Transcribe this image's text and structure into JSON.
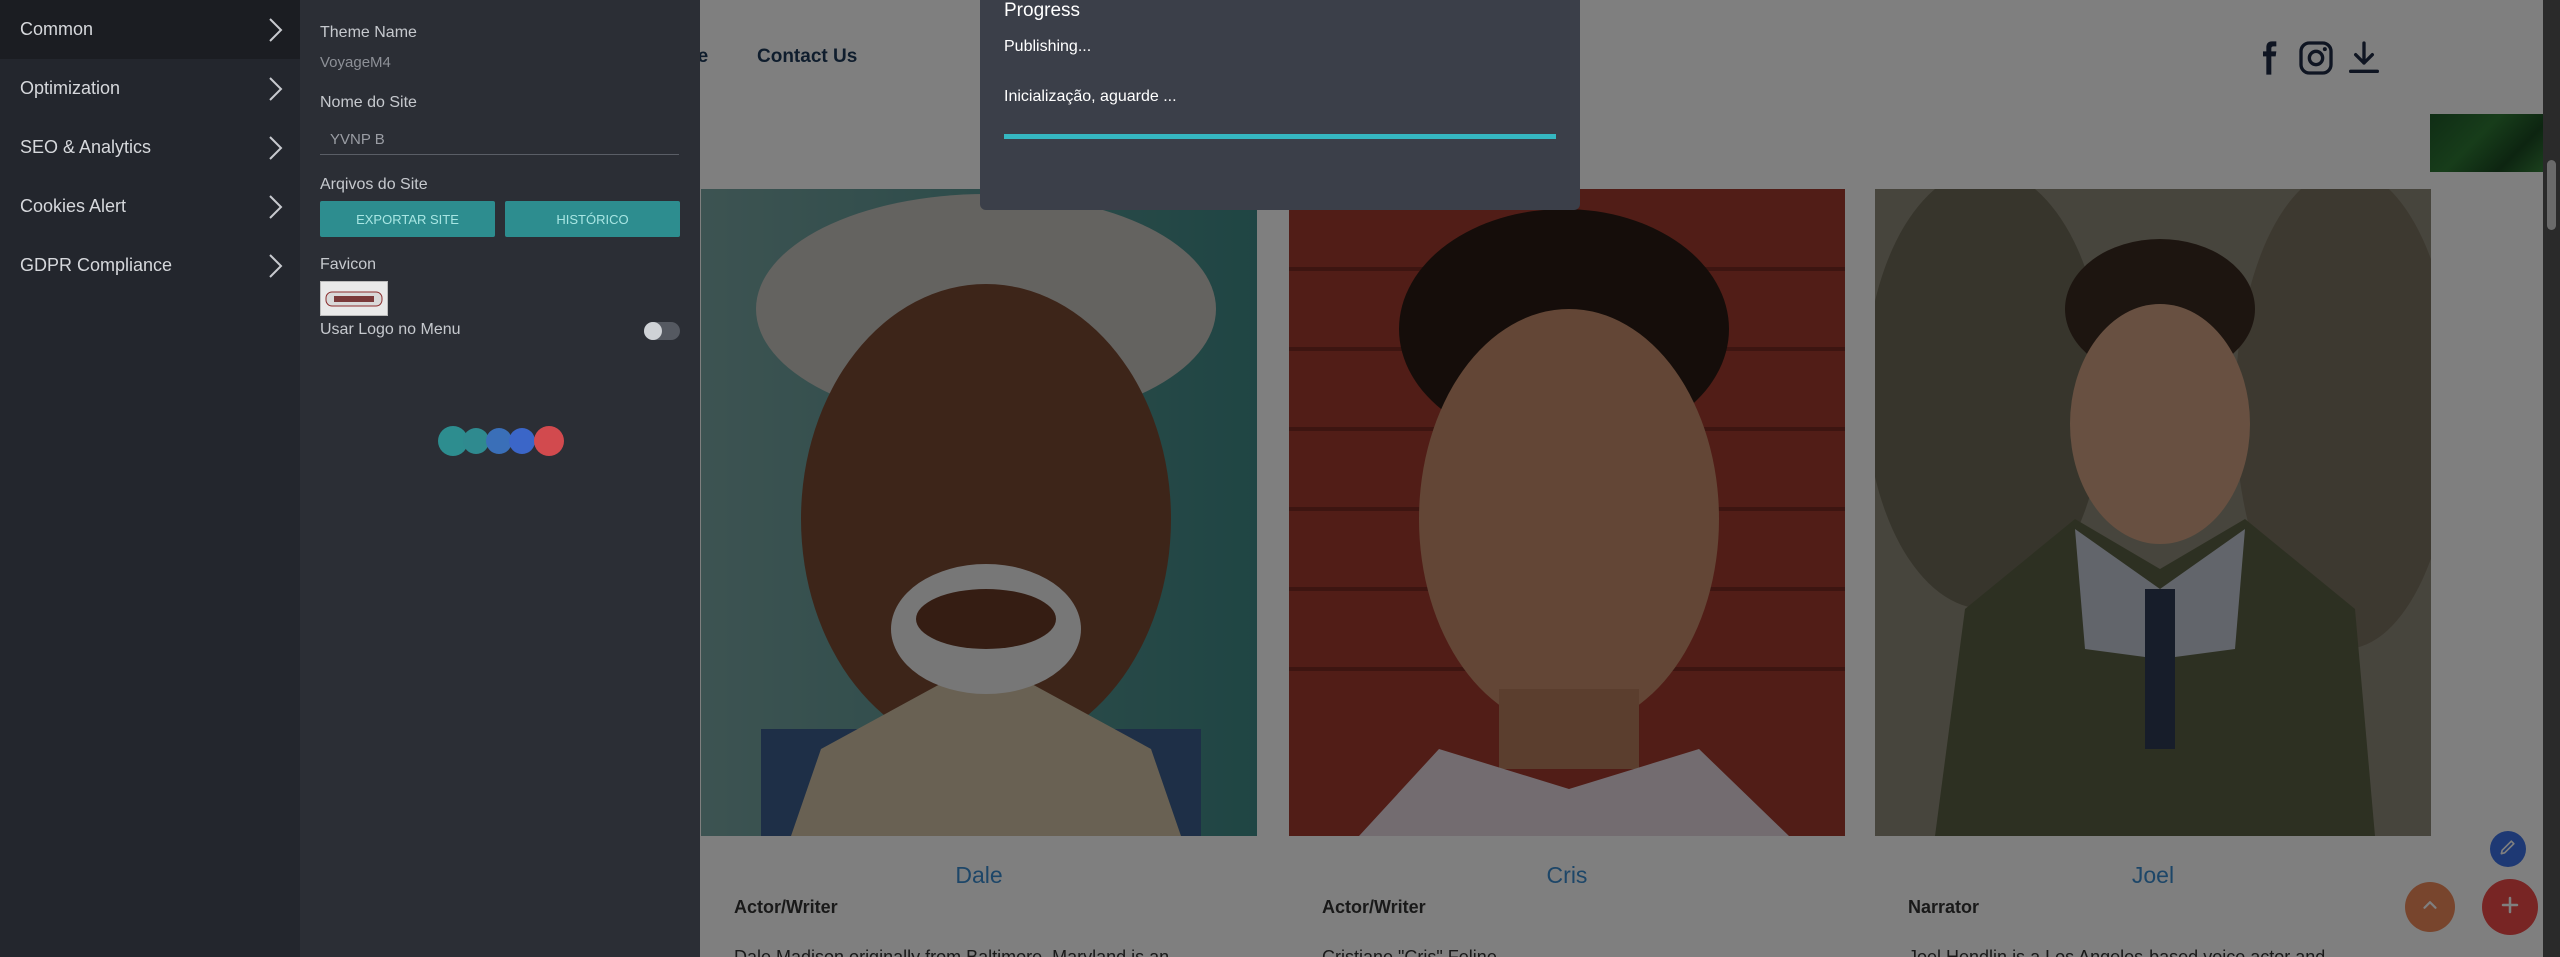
{
  "site": {
    "nav_partial": "pe",
    "nav_contact": "Contact Us",
    "social_icons": [
      "facebook-icon",
      "instagram-icon",
      "download-icon"
    ],
    "cards": [
      {
        "name": "Dale",
        "role": "Actor/Writer",
        "desc": "Dale Madison originally from Baltimore, Maryland is an"
      },
      {
        "name": "Cris",
        "role": "Actor/Writer",
        "desc": "Cristiane \"Cris\" Feline"
      },
      {
        "name": "Joel",
        "role": "Narrator",
        "desc": "Joel Hendlin is a Los Angeles-based voice actor and"
      }
    ],
    "fab_icons": [
      "pencil-icon",
      "arrow-up-icon",
      "plus-icon"
    ],
    "colors": {
      "name_link": "#3b8dd0",
      "fab_add": "#f04a48",
      "fab_up": "#f08a5b",
      "fab_edit": "#3c73e8"
    }
  },
  "menu": {
    "items": [
      {
        "label": "Common",
        "active": true
      },
      {
        "label": "Optimization"
      },
      {
        "label": "SEO & Analytics"
      },
      {
        "label": "Cookies Alert"
      },
      {
        "label": "GDPR Compliance"
      }
    ]
  },
  "settings": {
    "theme_name_label": "Theme Name",
    "theme_name_value": "VoyageM4",
    "site_name_label": "Nome do Site",
    "site_name_value": "YVNP B",
    "site_files_label": "Arqivos do Site",
    "export_button": "EXPORTAR SITE",
    "history_button": "HISTÓRICO",
    "favicon_label": "Favicon",
    "use_logo_label": "Usar Logo no Menu",
    "use_logo_enabled": false,
    "accent_color": "#2d8d8f"
  },
  "progress": {
    "title": "Progress",
    "status": "Publishing...",
    "message": "Inicialização, aguarde ...",
    "percent": 100,
    "bar_color": "#35b7c1"
  }
}
